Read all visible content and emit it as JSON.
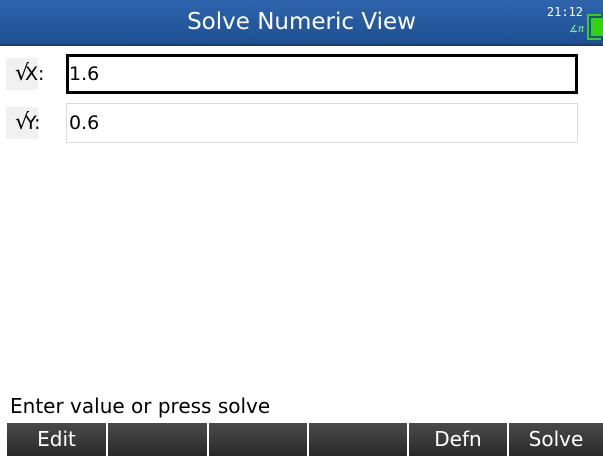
{
  "header": {
    "title": "Solve Numeric View",
    "time": "21:12",
    "angle_mode": "∡π"
  },
  "variables": [
    {
      "checked": true,
      "check_symbol": "√",
      "label": "X:",
      "value": "1.6",
      "selected": true
    },
    {
      "checked": true,
      "check_symbol": "√",
      "label": "Y:",
      "value": "0.6",
      "selected": false
    }
  ],
  "status_message": "Enter value or press solve",
  "softkeys": [
    "Edit",
    "",
    "",
    "",
    "Defn",
    "Solve"
  ],
  "colors": {
    "title_bar": "#1e4f92",
    "battery": "#35d214",
    "softkey_bg": "#333333"
  },
  "icons": {
    "battery": "battery-icon",
    "angle": "angle-mode-icon"
  }
}
